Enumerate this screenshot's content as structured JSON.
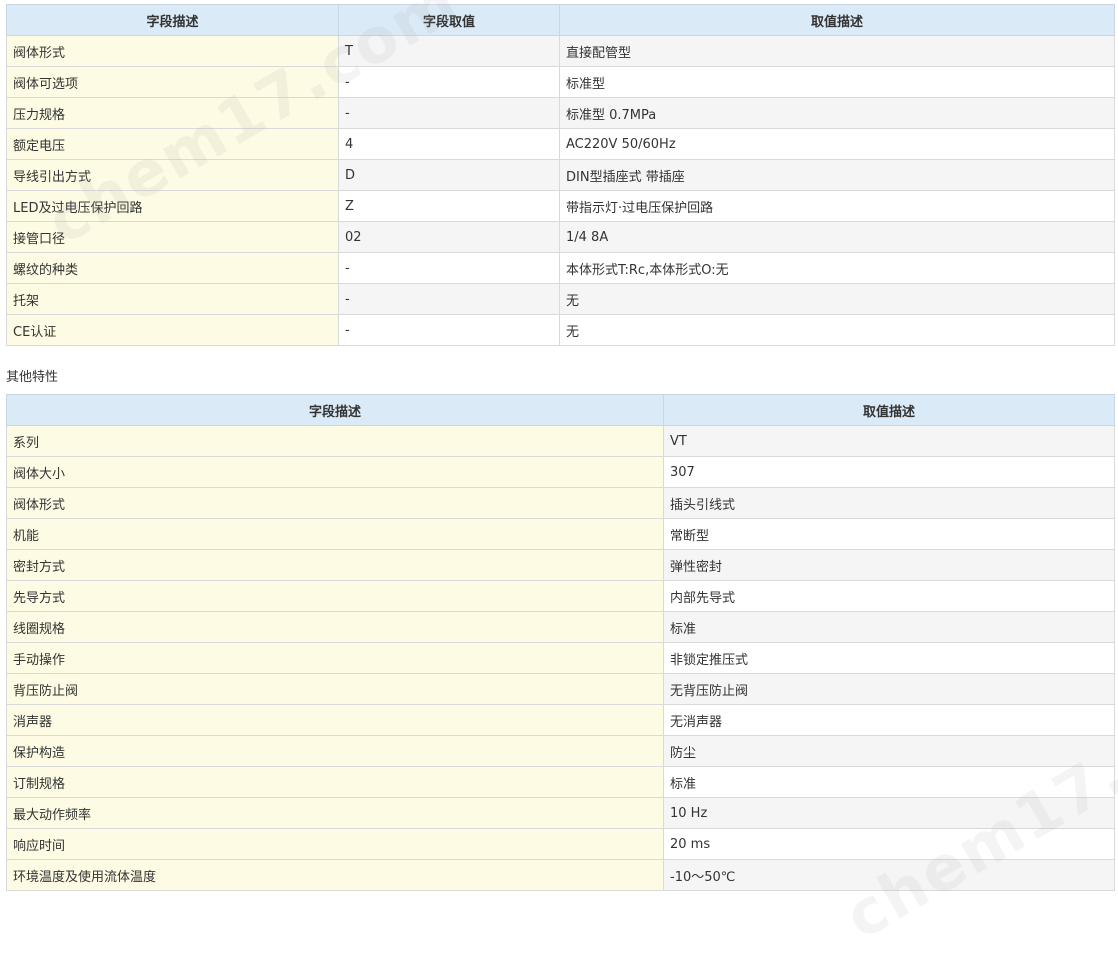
{
  "table1": {
    "headers": [
      "字段描述",
      "字段取值",
      "取值描述"
    ],
    "rows": [
      [
        "阀体形式",
        "T",
        "直接配管型"
      ],
      [
        "阀体可选项",
        "-",
        "标准型"
      ],
      [
        "压力规格",
        "-",
        "标准型 0.7MPa"
      ],
      [
        "额定电压",
        "4",
        "AC220V 50/60Hz"
      ],
      [
        "导线引出方式",
        "D",
        "DIN型插座式 带插座"
      ],
      [
        "LED及过电压保护回路",
        "Z",
        "带指示灯·过电压保护回路"
      ],
      [
        "接管口径",
        "02",
        "1/4 8A"
      ],
      [
        "螺纹的种类",
        "-",
        "本体形式T:Rc,本体形式O:无"
      ],
      [
        "托架",
        "-",
        "无"
      ],
      [
        "CE认证",
        "-",
        "无"
      ]
    ]
  },
  "section_title": "其他特性",
  "table2": {
    "headers": [
      "字段描述",
      "取值描述"
    ],
    "rows": [
      [
        "系列",
        "VT"
      ],
      [
        "阀体大小",
        "307"
      ],
      [
        "阀体形式",
        "插头引线式"
      ],
      [
        "机能",
        "常断型"
      ],
      [
        "密封方式",
        "弹性密封"
      ],
      [
        "先导方式",
        "内部先导式"
      ],
      [
        "线圈规格",
        "标准"
      ],
      [
        "手动操作",
        "非锁定推压式"
      ],
      [
        "背压防止阀",
        "无背压防止阀"
      ],
      [
        "消声器",
        "无消声器"
      ],
      [
        "保护构造",
        "防尘"
      ],
      [
        "订制规格",
        "标准"
      ],
      [
        "最大动作频率",
        "10 Hz"
      ],
      [
        "响应时间",
        "20 ms"
      ],
      [
        "环境温度及使用流体温度",
        "-10～50℃"
      ]
    ]
  },
  "watermark": "chem17.com",
  "colors": {
    "header_bg": "#daeaf7",
    "label_bg": "#fdfbe3",
    "alt_row_bg": "#f5f5f5",
    "border": "#d9d9d9"
  }
}
